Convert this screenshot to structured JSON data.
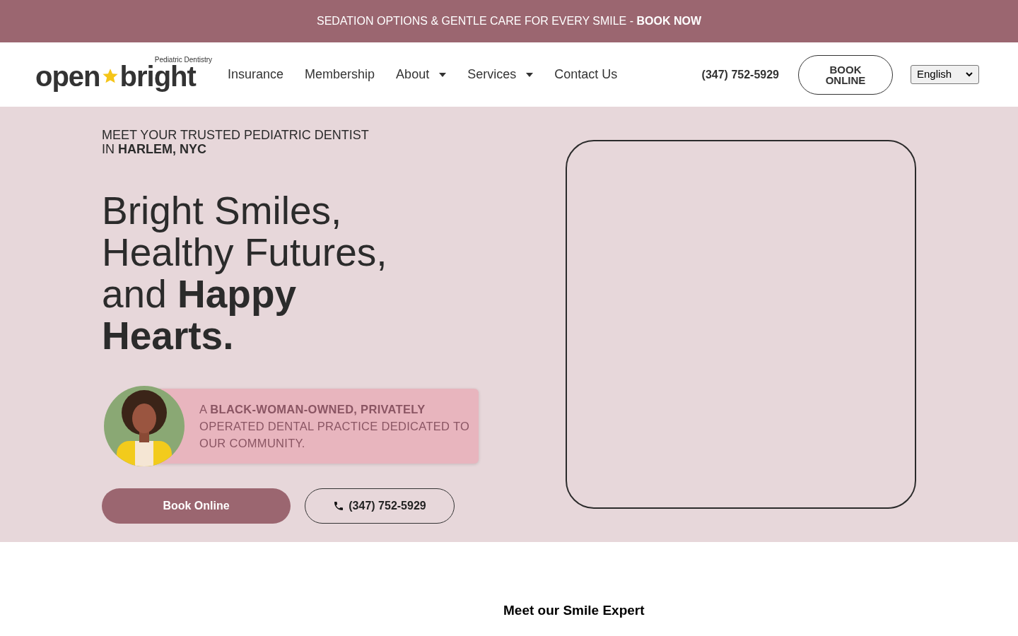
{
  "announcement": "SEDATION OPTIONS & GENTLE CARE FOR EVERY SMILE - **BOOK NOW**",
  "logo": {
    "tagline": "Pediatric Dentistry",
    "word_1": "open",
    "word_2": "bright"
  },
  "nav": [
    {
      "label": "Insurance",
      "dropdown": false
    },
    {
      "label": "Membership",
      "dropdown": false
    },
    {
      "label": "About",
      "dropdown": true
    },
    {
      "label": "Services",
      "dropdown": true
    },
    {
      "label": "Contact Us",
      "dropdown": false
    }
  ],
  "header_phone": "(347) 752-5929",
  "header_button": "BOOK ONLINE",
  "language": "English",
  "hero": {
    "eyebrow": "MEET YOUR TRUSTED PEDIATRIC DENTIST IN **HARLEM, NYC**",
    "headline": "Bright Smiles, Healthy Futures, and **Happy Hearts.**",
    "badge_text": "A **BLACK-WOMAN-OWNED, PRIVATELY** OPERATED DENTAL PRACTICE DEDICATED TO OUR COMMUNITY.",
    "primary_button": "Book Online",
    "phone_button": "(347) 752-5929"
  },
  "section_subtitle": "Meet our Smile Expert"
}
